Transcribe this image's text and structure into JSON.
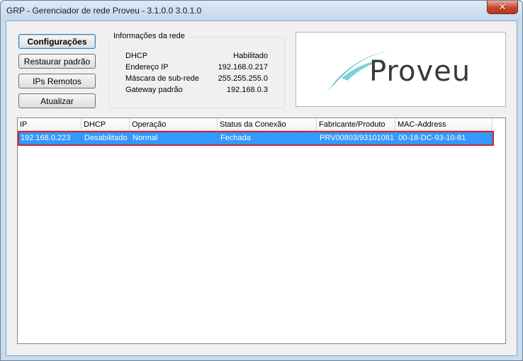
{
  "window": {
    "title": "GRP - Gerenciador de rede Proveu - 3.1.0.0 3.0.1.0",
    "close_label": "✕"
  },
  "buttons": {
    "config": "Configurações",
    "restore": "Restaurar padrão",
    "remote_ips": "IPs Remotos",
    "update": "Atualizar"
  },
  "network_info": {
    "legend": "Informações da rede",
    "rows": [
      {
        "label": "DHCP",
        "value": "Habilitado"
      },
      {
        "label": "Endereço IP",
        "value": "192.168.0.217"
      },
      {
        "label": "Máscara de sub-rede",
        "value": "255.255.255.0"
      },
      {
        "label": "Gateway padrão",
        "value": "192.168.0.3"
      }
    ]
  },
  "logo": {
    "text": "Proveu",
    "accent_color": "#3ab5c6"
  },
  "table": {
    "columns": [
      "IP",
      "DHCP",
      "Operação",
      "Status da Conexão",
      "Fabricante/Produto",
      "MAC-Address"
    ],
    "rows": [
      [
        "192.168.0.223",
        "Desabilitado",
        "Normal",
        "Fechada",
        "PRV00803/93101081",
        "00-18-DC-93-10-81"
      ]
    ],
    "selected_color": "#3399ff",
    "highlight_color": "#d1232a"
  }
}
